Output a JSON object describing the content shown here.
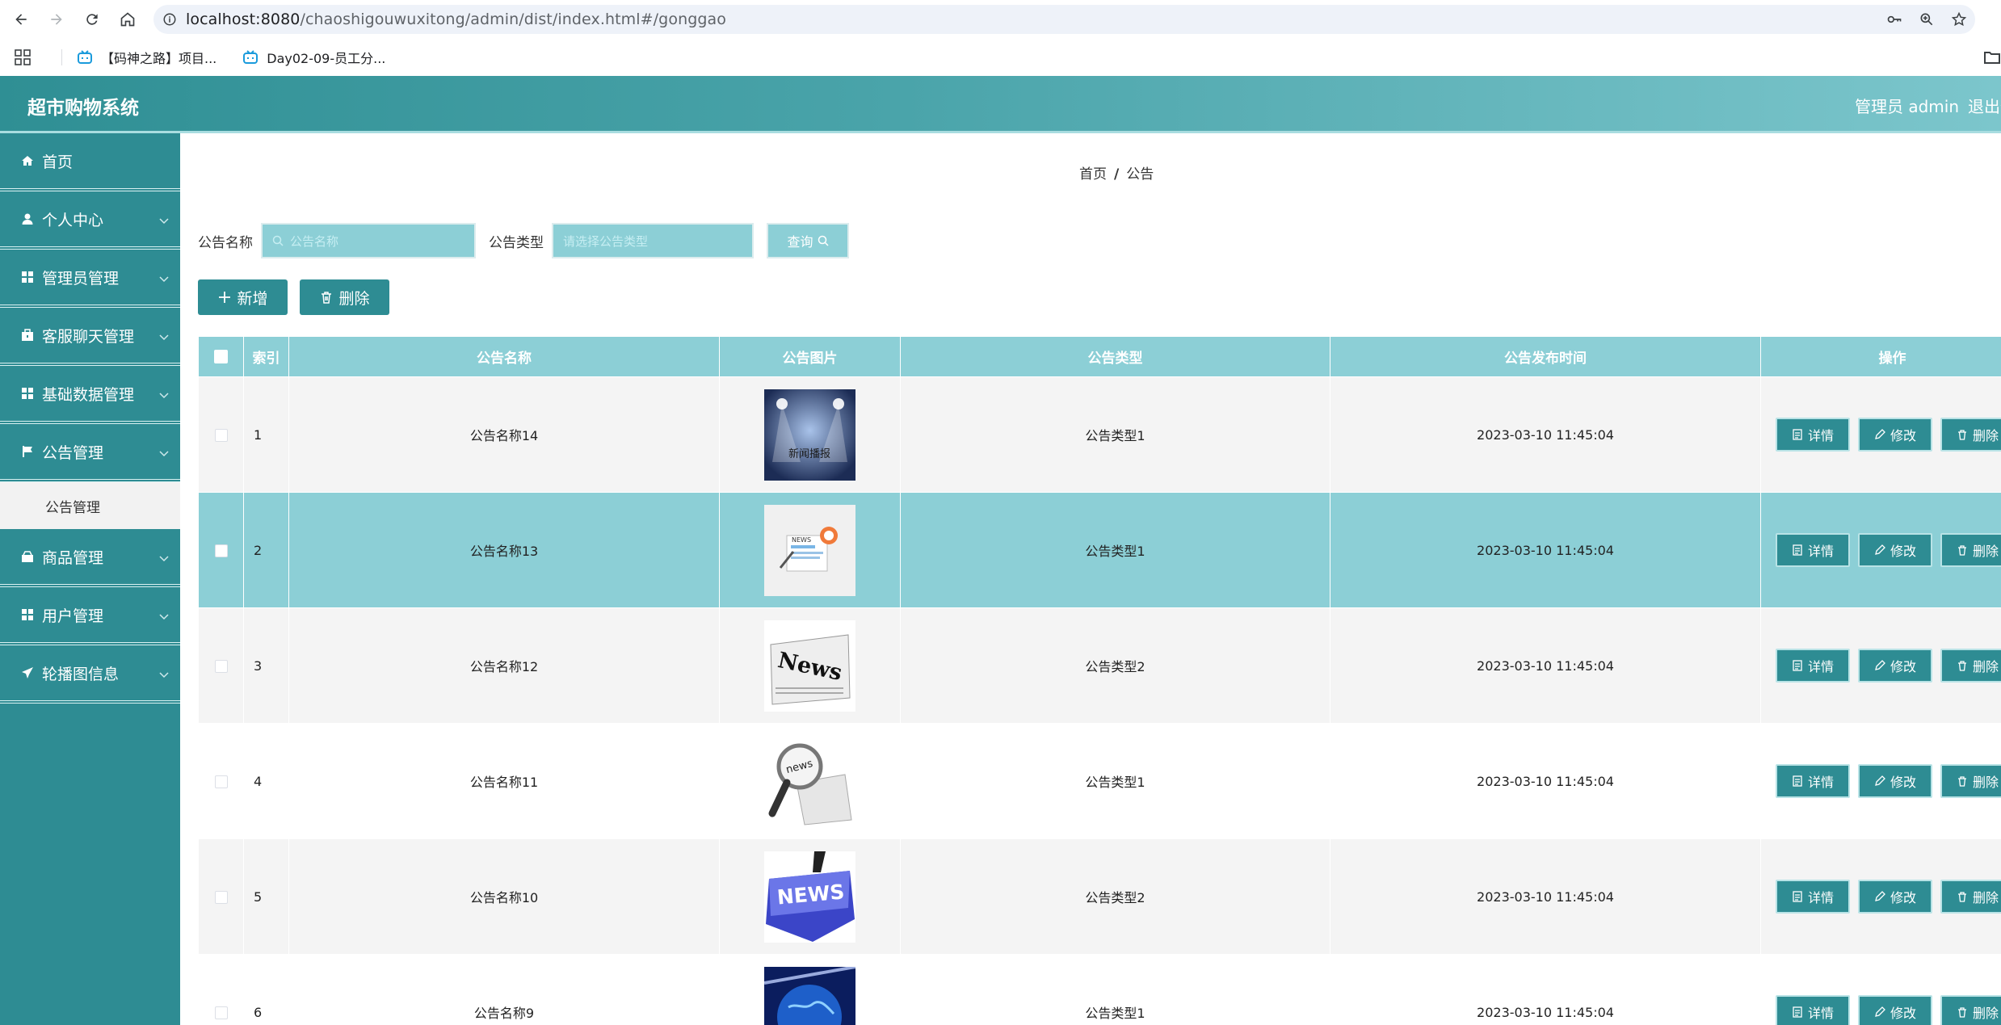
{
  "browser": {
    "url_host": "localhost:8080",
    "url_path": "/chaoshigouwuxitong/admin/dist/index.html#/gonggao",
    "bookmarks": [
      {
        "label": "【码神之路】项目..."
      },
      {
        "label": "Day02-09-员工分..."
      }
    ]
  },
  "header": {
    "title": "超市购物系统",
    "admin_label": "管理员 admin",
    "logout_label": "退出登录"
  },
  "sidebar": {
    "items": [
      {
        "label": "首页",
        "icon": "home-icon"
      },
      {
        "label": "个人中心",
        "icon": "user-icon"
      },
      {
        "label": "管理员管理",
        "icon": "grid-icon"
      },
      {
        "label": "客服聊天管理",
        "icon": "case-icon"
      },
      {
        "label": "基础数据管理",
        "icon": "grid-icon"
      },
      {
        "label": "公告管理",
        "icon": "flag-icon"
      },
      {
        "label": "商品管理",
        "icon": "goods-icon"
      },
      {
        "label": "用户管理",
        "icon": "grid-icon"
      },
      {
        "label": "轮播图信息",
        "icon": "send-icon"
      }
    ],
    "sub_item": "公告管理"
  },
  "breadcrumb": {
    "home": "首页",
    "sep": "/",
    "current": "公告"
  },
  "search": {
    "name_label": "公告名称",
    "name_placeholder": "公告名称",
    "type_label": "公告类型",
    "type_placeholder": "请选择公告类型",
    "query_label": "查询"
  },
  "actions": {
    "add_label": "新增",
    "delete_label": "删除"
  },
  "table": {
    "headers": [
      "索引",
      "公告名称",
      "公告图片",
      "公告类型",
      "公告发布时间",
      "操作"
    ],
    "rows": [
      {
        "index": "1",
        "name": "公告名称14",
        "type": "公告类型1",
        "time": "2023-03-10 11:45:04",
        "image": "stage-news"
      },
      {
        "index": "2",
        "name": "公告名称13",
        "type": "公告类型1",
        "time": "2023-03-10 11:45:04",
        "image": "news-paper"
      },
      {
        "index": "3",
        "name": "公告名称12",
        "type": "公告类型2",
        "time": "2023-03-10 11:45:04",
        "image": "news-newspaper"
      },
      {
        "index": "4",
        "name": "公告名称11",
        "type": "公告类型1",
        "time": "2023-03-10 11:45:04",
        "image": "news-magnifier"
      },
      {
        "index": "5",
        "name": "公告名称10",
        "type": "公告类型2",
        "time": "2023-03-10 11:45:04",
        "image": "news-key"
      },
      {
        "index": "6",
        "name": "公告名称9",
        "type": "公告类型1",
        "time": "2023-03-10 11:45:04",
        "image": "globe"
      }
    ],
    "ops": {
      "detail": "详情",
      "edit": "修改",
      "delete": "删除"
    },
    "stage_text": "新闻播报",
    "news_text": "NEWS",
    "news_lower": "news",
    "news_word": "News"
  },
  "colors": {
    "primary": "#2e8c93",
    "light": "#8ccfd6",
    "row_alt": "#f4f4f4"
  }
}
